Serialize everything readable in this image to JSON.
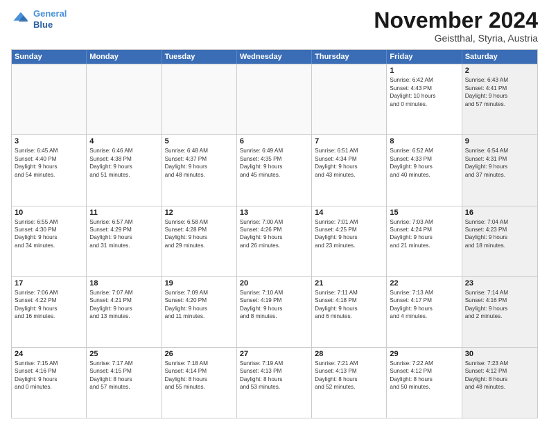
{
  "logo": {
    "line1": "General",
    "line2": "Blue"
  },
  "title": "November 2024",
  "subtitle": "Geistthal, Styria, Austria",
  "weekdays": [
    "Sunday",
    "Monday",
    "Tuesday",
    "Wednesday",
    "Thursday",
    "Friday",
    "Saturday"
  ],
  "rows": [
    [
      {
        "day": "",
        "info": "",
        "shaded": false,
        "empty": true
      },
      {
        "day": "",
        "info": "",
        "shaded": false,
        "empty": true
      },
      {
        "day": "",
        "info": "",
        "shaded": false,
        "empty": true
      },
      {
        "day": "",
        "info": "",
        "shaded": false,
        "empty": true
      },
      {
        "day": "",
        "info": "",
        "shaded": false,
        "empty": true
      },
      {
        "day": "1",
        "info": "Sunrise: 6:42 AM\nSunset: 4:43 PM\nDaylight: 10 hours\nand 0 minutes.",
        "shaded": false
      },
      {
        "day": "2",
        "info": "Sunrise: 6:43 AM\nSunset: 4:41 PM\nDaylight: 9 hours\nand 57 minutes.",
        "shaded": true
      }
    ],
    [
      {
        "day": "3",
        "info": "Sunrise: 6:45 AM\nSunset: 4:40 PM\nDaylight: 9 hours\nand 54 minutes.",
        "shaded": false
      },
      {
        "day": "4",
        "info": "Sunrise: 6:46 AM\nSunset: 4:38 PM\nDaylight: 9 hours\nand 51 minutes.",
        "shaded": false
      },
      {
        "day": "5",
        "info": "Sunrise: 6:48 AM\nSunset: 4:37 PM\nDaylight: 9 hours\nand 48 minutes.",
        "shaded": false
      },
      {
        "day": "6",
        "info": "Sunrise: 6:49 AM\nSunset: 4:35 PM\nDaylight: 9 hours\nand 45 minutes.",
        "shaded": false
      },
      {
        "day": "7",
        "info": "Sunrise: 6:51 AM\nSunset: 4:34 PM\nDaylight: 9 hours\nand 43 minutes.",
        "shaded": false
      },
      {
        "day": "8",
        "info": "Sunrise: 6:52 AM\nSunset: 4:33 PM\nDaylight: 9 hours\nand 40 minutes.",
        "shaded": false
      },
      {
        "day": "9",
        "info": "Sunrise: 6:54 AM\nSunset: 4:31 PM\nDaylight: 9 hours\nand 37 minutes.",
        "shaded": true
      }
    ],
    [
      {
        "day": "10",
        "info": "Sunrise: 6:55 AM\nSunset: 4:30 PM\nDaylight: 9 hours\nand 34 minutes.",
        "shaded": false
      },
      {
        "day": "11",
        "info": "Sunrise: 6:57 AM\nSunset: 4:29 PM\nDaylight: 9 hours\nand 31 minutes.",
        "shaded": false
      },
      {
        "day": "12",
        "info": "Sunrise: 6:58 AM\nSunset: 4:28 PM\nDaylight: 9 hours\nand 29 minutes.",
        "shaded": false
      },
      {
        "day": "13",
        "info": "Sunrise: 7:00 AM\nSunset: 4:26 PM\nDaylight: 9 hours\nand 26 minutes.",
        "shaded": false
      },
      {
        "day": "14",
        "info": "Sunrise: 7:01 AM\nSunset: 4:25 PM\nDaylight: 9 hours\nand 23 minutes.",
        "shaded": false
      },
      {
        "day": "15",
        "info": "Sunrise: 7:03 AM\nSunset: 4:24 PM\nDaylight: 9 hours\nand 21 minutes.",
        "shaded": false
      },
      {
        "day": "16",
        "info": "Sunrise: 7:04 AM\nSunset: 4:23 PM\nDaylight: 9 hours\nand 18 minutes.",
        "shaded": true
      }
    ],
    [
      {
        "day": "17",
        "info": "Sunrise: 7:06 AM\nSunset: 4:22 PM\nDaylight: 9 hours\nand 16 minutes.",
        "shaded": false
      },
      {
        "day": "18",
        "info": "Sunrise: 7:07 AM\nSunset: 4:21 PM\nDaylight: 9 hours\nand 13 minutes.",
        "shaded": false
      },
      {
        "day": "19",
        "info": "Sunrise: 7:09 AM\nSunset: 4:20 PM\nDaylight: 9 hours\nand 11 minutes.",
        "shaded": false
      },
      {
        "day": "20",
        "info": "Sunrise: 7:10 AM\nSunset: 4:19 PM\nDaylight: 9 hours\nand 8 minutes.",
        "shaded": false
      },
      {
        "day": "21",
        "info": "Sunrise: 7:11 AM\nSunset: 4:18 PM\nDaylight: 9 hours\nand 6 minutes.",
        "shaded": false
      },
      {
        "day": "22",
        "info": "Sunrise: 7:13 AM\nSunset: 4:17 PM\nDaylight: 9 hours\nand 4 minutes.",
        "shaded": false
      },
      {
        "day": "23",
        "info": "Sunrise: 7:14 AM\nSunset: 4:16 PM\nDaylight: 9 hours\nand 2 minutes.",
        "shaded": true
      }
    ],
    [
      {
        "day": "24",
        "info": "Sunrise: 7:15 AM\nSunset: 4:16 PM\nDaylight: 9 hours\nand 0 minutes.",
        "shaded": false
      },
      {
        "day": "25",
        "info": "Sunrise: 7:17 AM\nSunset: 4:15 PM\nDaylight: 8 hours\nand 57 minutes.",
        "shaded": false
      },
      {
        "day": "26",
        "info": "Sunrise: 7:18 AM\nSunset: 4:14 PM\nDaylight: 8 hours\nand 55 minutes.",
        "shaded": false
      },
      {
        "day": "27",
        "info": "Sunrise: 7:19 AM\nSunset: 4:13 PM\nDaylight: 8 hours\nand 53 minutes.",
        "shaded": false
      },
      {
        "day": "28",
        "info": "Sunrise: 7:21 AM\nSunset: 4:13 PM\nDaylight: 8 hours\nand 52 minutes.",
        "shaded": false
      },
      {
        "day": "29",
        "info": "Sunrise: 7:22 AM\nSunset: 4:12 PM\nDaylight: 8 hours\nand 50 minutes.",
        "shaded": false
      },
      {
        "day": "30",
        "info": "Sunrise: 7:23 AM\nSunset: 4:12 PM\nDaylight: 8 hours\nand 48 minutes.",
        "shaded": true
      }
    ]
  ]
}
